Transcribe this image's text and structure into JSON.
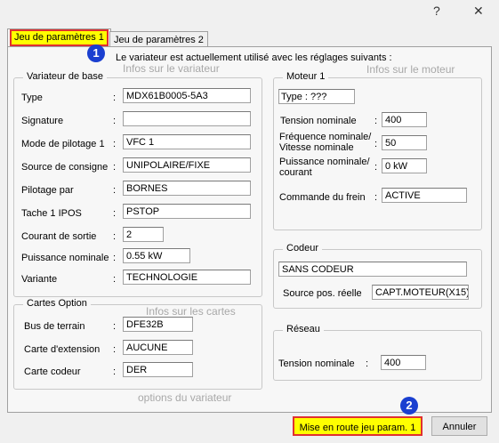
{
  "window": {
    "help_label": "?",
    "close_label": "✕"
  },
  "tabs": [
    "Jeu de paramètres 1",
    "Jeu de paramètres 2"
  ],
  "markers": {
    "m1": "1",
    "m2": "2"
  },
  "intro": "Le variateur est actuellement utilisé avec les réglages suivants :",
  "ghost": {
    "variateur": "Infos sur le variateur",
    "moteur": "Infos sur le moteur",
    "cartes": "Infos sur les cartes",
    "options": "options du variateur"
  },
  "variateur": {
    "title": "Variateur de base",
    "rows": [
      {
        "label": "Type",
        "value": "MDX61B0005-5A3"
      },
      {
        "label": "Signature",
        "value": ""
      },
      {
        "label": "Mode de pilotage 1",
        "value": "VFC 1"
      },
      {
        "label": "Source de consigne",
        "value": "UNIPOLAIRE/FIXE"
      },
      {
        "label": "Pilotage par",
        "value": "BORNES"
      },
      {
        "label": "Tache 1 IPOS",
        "value": "PSTOP"
      },
      {
        "label": "Courant de sortie",
        "value": "2"
      },
      {
        "label": "Puissance nominale",
        "value": "0.55 kW"
      },
      {
        "label": "Variante",
        "value": "TECHNOLOGIE"
      }
    ]
  },
  "cartes": {
    "title": "Cartes Option",
    "rows": [
      {
        "label": "Bus de terrain",
        "value": "DFE32B"
      },
      {
        "label": "Carte d'extension",
        "value": "AUCUNE"
      },
      {
        "label": "Carte codeur",
        "value": "DER"
      }
    ]
  },
  "moteur": {
    "title": "Moteur 1",
    "type_label": "Type :",
    "type_value": "???",
    "tension_label": "Tension nominale",
    "tension_value": "400",
    "freq_label1": "Fréquence nominale/",
    "freq_label2": "Vitesse nominale",
    "freq_value": "50",
    "puiss_label1": "Puissance nominale/",
    "puiss_label2": "courant",
    "puiss_value": "0 kW",
    "frein_label": "Commande du frein",
    "frein_value": "ACTIVE"
  },
  "codeur": {
    "title": "Codeur",
    "value": "SANS CODEUR",
    "source_label": "Source pos. réelle",
    "source_value": "CAPT.MOTEUR(X15)"
  },
  "reseau": {
    "title": "Réseau",
    "tension_label": "Tension nominale",
    "tension_value": "400"
  },
  "buttons": {
    "start": "Mise en route jeu param. 1",
    "cancel": "Annuler"
  }
}
